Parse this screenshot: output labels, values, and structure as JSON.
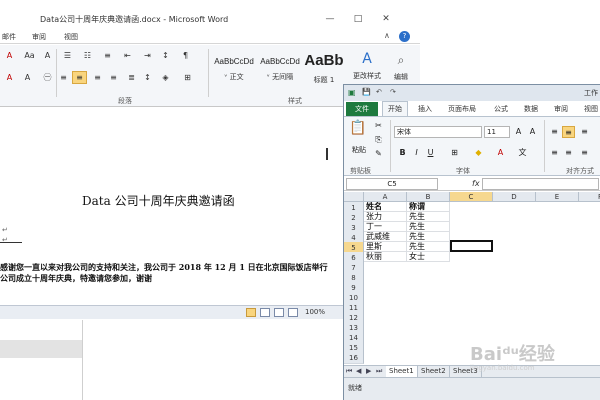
{
  "word": {
    "title": "Data公司十周年庆典邀请函.docx - Microsoft Word",
    "controls": [
      "—",
      "□",
      "✕"
    ],
    "menus": [
      "邮件",
      "审阅",
      "视图"
    ],
    "help": "?",
    "caret": "∧",
    "ribbon": {
      "styles": [
        {
          "sample": "AaBbCcDd",
          "name": "ᵛ 正文"
        },
        {
          "sample": "AaBbCcDd",
          "name": "ᵛ 无间隔"
        },
        {
          "sample": "AaBb",
          "name": "标题 1"
        }
      ],
      "change_styles": "更改样式",
      "edit": "编辑",
      "group_paragraph": "段落",
      "group_styles": "样式"
    },
    "doc": {
      "title": "Data 公司十周年庆典邀请函",
      "line1": "感谢您一直以来对我公司的支持和关注，我公司于 2018 年 12 月 1 日在北京国际饭店举行",
      "line2": "公司成立十周年庆典，特邀请您参加，谢谢",
      "para_mark": "↵"
    },
    "status": {
      "zoom": "100%"
    }
  },
  "excel": {
    "title": "工作",
    "file_tab": "文件",
    "tabs": [
      "开始",
      "插入",
      "页面布局",
      "公式",
      "数据",
      "审阅",
      "视图"
    ],
    "font_name": "宋体",
    "font_size": "11",
    "paste": "粘贴",
    "groups": [
      "剪贴板",
      "字体",
      "对齐方式"
    ],
    "name_box": "C5",
    "fx": "fx",
    "columns": [
      "A",
      "B",
      "C",
      "D",
      "E",
      "F"
    ],
    "rows": [
      "1",
      "2",
      "3",
      "4",
      "5",
      "6",
      "7",
      "8",
      "9",
      "10",
      "11",
      "12",
      "13",
      "14",
      "15",
      "16"
    ],
    "table": [
      [
        "姓名",
        "称谓"
      ],
      [
        "张力",
        "先生"
      ],
      [
        "丁一",
        "先生"
      ],
      [
        "武威维",
        "先生"
      ],
      [
        "里斯",
        "先生"
      ],
      [
        "秋丽",
        "女士"
      ]
    ],
    "sheets": [
      "Sheet1",
      "Sheet2",
      "Sheet3"
    ],
    "status": "就绪"
  },
  "watermark": {
    "text": "Baiᵈᵘ经验",
    "sub": "jingyan.baidu.com"
  }
}
